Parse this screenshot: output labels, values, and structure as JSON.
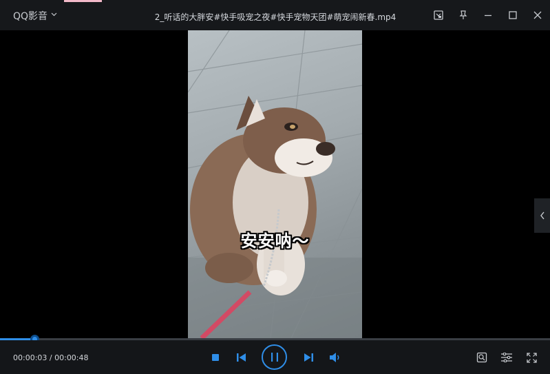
{
  "app": {
    "name": "QQ影音"
  },
  "file": {
    "title": "2_听话的大胖安#快手吸宠之夜#快手宠物天团#萌宠闹新春.mp4"
  },
  "video": {
    "subtitle": "安安呐～"
  },
  "playback": {
    "current_time": "00:00:03",
    "separator": " / ",
    "duration": "00:00:48",
    "progress_fraction": 0.0625
  },
  "colors": {
    "accent": "#2f8ee8",
    "titlebar": "#16181b",
    "controlbar": "#141619"
  },
  "icons": {
    "title_left": [
      "screenshot-panel-icon",
      "pin-icon",
      "minimize-icon",
      "maximize-icon",
      "close-icon"
    ],
    "controls": [
      "stop-icon",
      "previous-icon",
      "pause-icon",
      "next-icon",
      "volume-icon"
    ],
    "right_tools": [
      "screenshot-tool-icon",
      "settings-sliders-icon",
      "fullscreen-icon"
    ]
  }
}
